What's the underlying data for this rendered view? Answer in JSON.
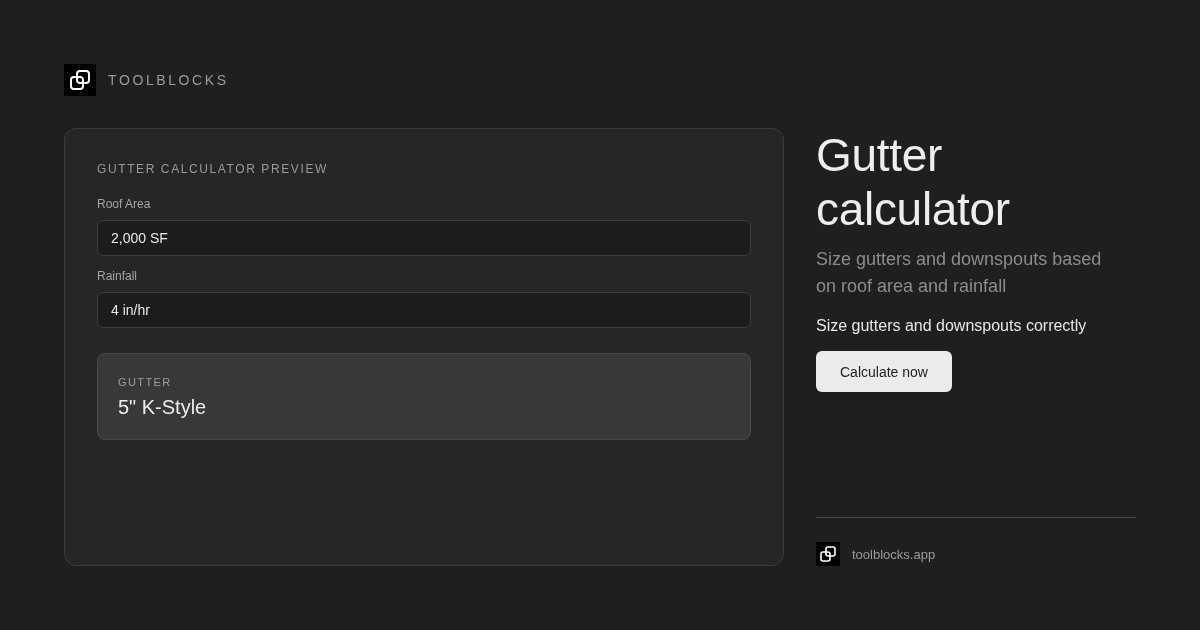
{
  "brand": {
    "name": "TOOLBLOCKS"
  },
  "preview": {
    "title": "GUTTER CALCULATOR PREVIEW",
    "fields": [
      {
        "label": "Roof Area",
        "value": "2,000 SF"
      },
      {
        "label": "Rainfall",
        "value": "4 in/hr"
      }
    ],
    "result": {
      "label": "GUTTER",
      "value": "5\" K-Style"
    }
  },
  "hero": {
    "title": "Gutter calculator",
    "subtitle": "Size gutters and downspouts based on roof area and rainfall",
    "tagline": "Size gutters and downspouts correctly",
    "button": "Calculate now"
  },
  "footer": {
    "url": "toolblocks.app"
  }
}
